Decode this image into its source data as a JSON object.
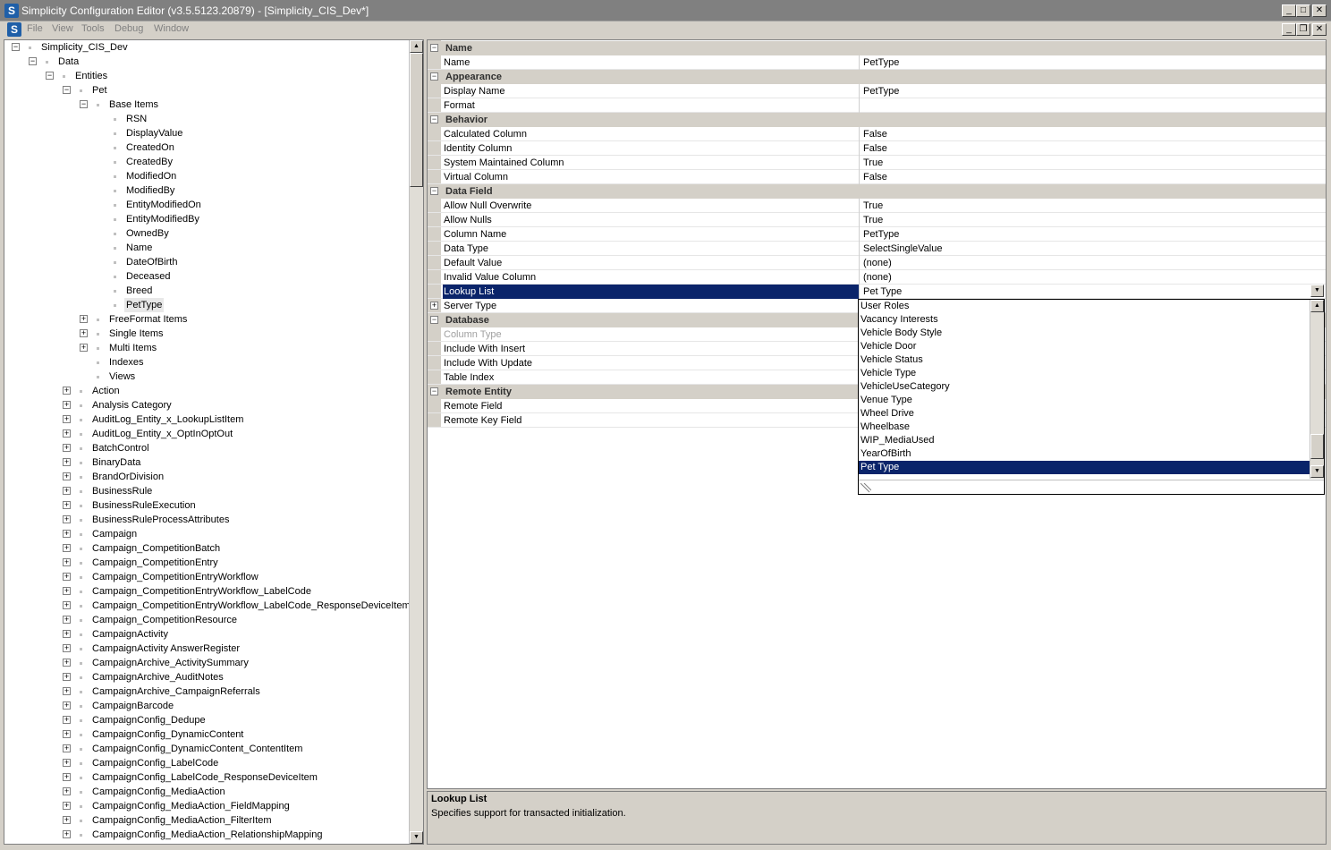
{
  "window": {
    "title": "Simplicity Configuration Editor (v3.5.5123.20879) - [Simplicity_CIS_Dev*]",
    "app_icon": "S",
    "minimize": "_",
    "maximize": "□",
    "close": "✕"
  },
  "menu": {
    "icon": "S",
    "items": [
      "File",
      "View",
      "Tools",
      "Debug",
      "Window"
    ],
    "mdi_minimize": "_",
    "mdi_restore": "❐",
    "mdi_close": "✕"
  },
  "tree": {
    "root": "Simplicity_CIS_Dev",
    "data": "Data",
    "entities": "Entities",
    "pet": "Pet",
    "base_items": "Base Items",
    "base_children": [
      "RSN",
      "DisplayValue",
      "CreatedOn",
      "CreatedBy",
      "ModifiedOn",
      "ModifiedBy",
      "EntityModifiedOn",
      "EntityModifiedBy",
      "OwnedBy",
      "Name",
      "DateOfBirth",
      "Deceased",
      "Breed",
      "PetType"
    ],
    "pet_groups": [
      "FreeFormat Items",
      "Single Items",
      "Multi Items",
      "Indexes",
      "Views"
    ],
    "entities_list": [
      "Action",
      "Analysis Category",
      "AuditLog_Entity_x_LookupListItem",
      "AuditLog_Entity_x_OptInOptOut",
      "BatchControl",
      "BinaryData",
      "BrandOrDivision",
      "BusinessRule",
      "BusinessRuleExecution",
      "BusinessRuleProcessAttributes",
      "Campaign",
      "Campaign_CompetitionBatch",
      "Campaign_CompetitionEntry",
      "Campaign_CompetitionEntryWorkflow",
      "Campaign_CompetitionEntryWorkflow_LabelCode",
      "Campaign_CompetitionEntryWorkflow_LabelCode_ResponseDeviceItem",
      "Campaign_CompetitionResource",
      "CampaignActivity",
      "CampaignActivity AnswerRegister",
      "CampaignArchive_ActivitySummary",
      "CampaignArchive_AuditNotes",
      "CampaignArchive_CampaignReferrals",
      "CampaignBarcode",
      "CampaignConfig_Dedupe",
      "CampaignConfig_DynamicContent",
      "CampaignConfig_DynamicContent_ContentItem",
      "CampaignConfig_LabelCode",
      "CampaignConfig_LabelCode_ResponseDeviceItem",
      "CampaignConfig_MediaAction",
      "CampaignConfig_MediaAction_FieldMapping",
      "CampaignConfig_MediaAction_FilterItem",
      "CampaignConfig_MediaAction_RelationshipMapping"
    ],
    "expand_minus": "−",
    "expand_plus": "+"
  },
  "properties": {
    "cat_name": "Name",
    "name_label": "Name",
    "name_value": "PetType",
    "cat_appearance": "Appearance",
    "display_name_label": "Display Name",
    "display_name_value": "PetType",
    "format_label": "Format",
    "format_value": "",
    "cat_behavior": "Behavior",
    "calc_col_label": "Calculated Column",
    "calc_col_value": "False",
    "identity_col_label": "Identity Column",
    "identity_col_value": "False",
    "sys_maint_label": "System Maintained Column",
    "sys_maint_value": "True",
    "virtual_col_label": "Virtual Column",
    "virtual_col_value": "False",
    "cat_data_field": "Data Field",
    "allow_null_overwrite_label": "Allow Null Overwrite",
    "allow_null_overwrite_value": "True",
    "allow_nulls_label": "Allow Nulls",
    "allow_nulls_value": "True",
    "column_name_label": "Column Name",
    "column_name_value": "PetType",
    "data_type_label": "Data Type",
    "data_type_value": "SelectSingleValue",
    "default_value_label": "Default Value",
    "default_value_value": "(none)",
    "invalid_value_col_label": "Invalid Value Column",
    "invalid_value_col_value": "(none)",
    "lookup_list_label": "Lookup List",
    "lookup_list_value": "Pet Type",
    "server_type_label": "Server Type",
    "cat_database": "Database",
    "column_type_label": "Column Type",
    "include_insert_label": "Include With Insert",
    "include_update_label": "Include With Update",
    "table_index_label": "Table Index",
    "cat_remote_entity": "Remote Entity",
    "remote_field_label": "Remote Field",
    "remote_key_field_label": "Remote Key Field"
  },
  "dropdown": {
    "items": [
      "User Roles",
      "Vacancy Interests",
      "Vehicle Body Style",
      "Vehicle Door",
      "Vehicle Status",
      "Vehicle Type",
      "VehicleUseCategory",
      "Venue Type",
      "Wheel Drive",
      "Wheelbase",
      "WIP_MediaUsed",
      "YearOfBirth",
      "Pet Type"
    ],
    "selected": "Pet Type"
  },
  "help": {
    "title": "Lookup List",
    "description": "Specifies support for transacted initialization."
  }
}
